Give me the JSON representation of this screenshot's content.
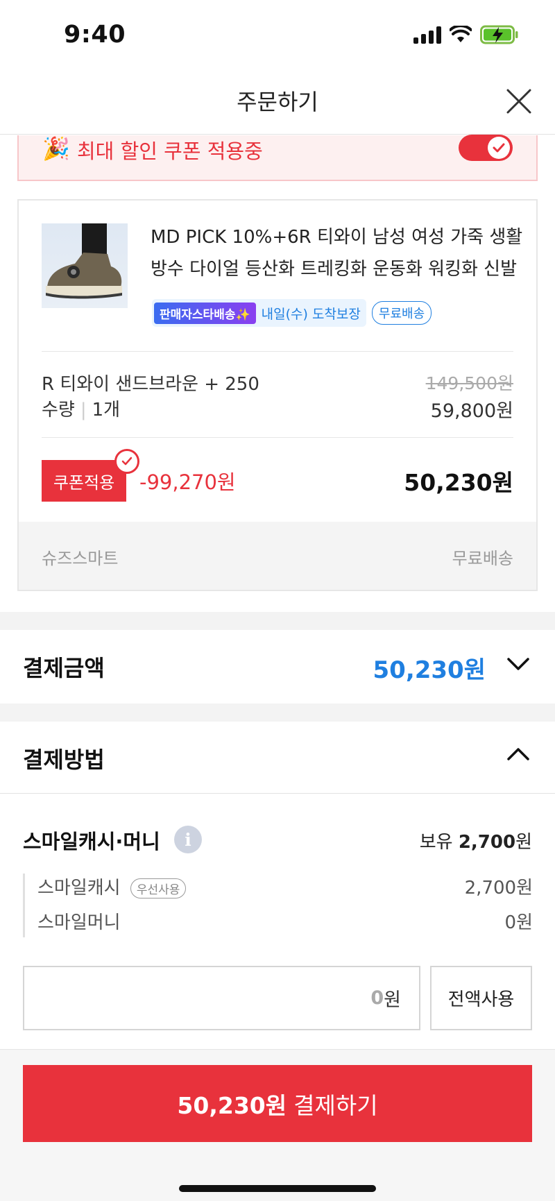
{
  "status_bar": {
    "time": "9:40"
  },
  "header": {
    "title": "주문하기"
  },
  "coupon_banner": {
    "emoji": "🎉",
    "text": "최대 할인 쿠폰 적용중",
    "toggle_on": true
  },
  "product": {
    "name": "MD PICK 10%+6R 티와이 남성 여성 가죽 생활 방수 다이얼 등산화 트레킹화 운동화 워킹화 신발",
    "star_delivery_tag": "판매자스타배송✨",
    "arrival_text": "내일(수) 도착보장",
    "free_shipping_badge": "무료배송",
    "option": "R 티와이 샌드브라운 + 250",
    "quantity_label": "수량",
    "quantity_value": "1개",
    "original_price": "149,500원",
    "sale_price": "59,800원",
    "coupon_button": "쿠폰적용",
    "discount": "-99,270원",
    "final_price": "50,230원",
    "seller": "슈즈스마트",
    "shipping": "무료배송"
  },
  "payment_amount": {
    "label": "결제금액",
    "value": "50,230원"
  },
  "payment_method": {
    "label": "결제방법",
    "smile": {
      "title": "스마일캐시·머니",
      "info_icon": "i",
      "holding_label": "보유",
      "holding_value": "2,700",
      "holding_unit": "원",
      "cash_label": "스마일캐시",
      "cash_badge": "우선사용",
      "cash_value": "2,700원",
      "money_label": "스마일머니",
      "money_value": "0원",
      "input_value": "0",
      "input_unit": "원",
      "use_all_button": "전액사용"
    }
  },
  "pay_button": {
    "amount": "50,230원",
    "label": "결제하기"
  },
  "colors": {
    "accent_red": "#e8323c",
    "accent_blue": "#1f7fe0"
  }
}
